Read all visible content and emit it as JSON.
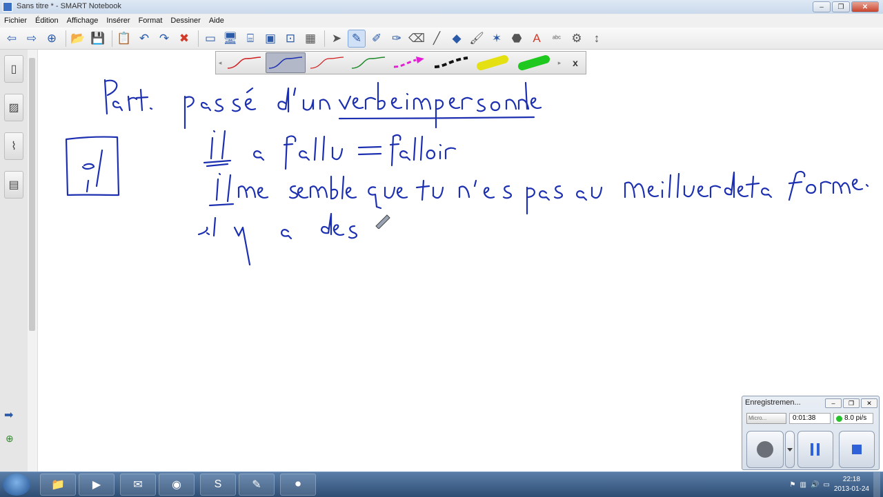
{
  "window": {
    "title": "Sans titre * - SMART Notebook",
    "minimize": "‒",
    "maximize": "❐",
    "close": "✕"
  },
  "menu": [
    "Fichier",
    "Édition",
    "Affichage",
    "Insérer",
    "Format",
    "Dessiner",
    "Aide"
  ],
  "toolbar": {
    "back_icon": "⇦",
    "forward_icon": "⇨",
    "add_page_icon": "⊕",
    "open_icon": "📂",
    "save_icon": "💾",
    "paste_icon": "📋",
    "undo_icon": "↶",
    "redo_icon": "↷",
    "delete_icon": "✖",
    "screen_shade_icon": "▭",
    "display_icon": "🖥",
    "document_camera_icon": "⌸",
    "presentation_icon": "▣",
    "capture_icon": "⊡",
    "table_icon": "▦",
    "select_icon": "➤",
    "pen_icon": "✎",
    "creative_pen_icon": "✐",
    "magic_pen_icon": "✑",
    "eraser_icon": "⌫",
    "line_icon": "╱",
    "shape_icon": "◆",
    "fill_icon": "🖌",
    "magic_icon": "✶",
    "paint_icon": "⬣",
    "text_icon": "A",
    "spellcheck_icon": "ᵃᵇᶜ",
    "measure_icon": "⚙",
    "more_icon": "↕"
  },
  "pen_tray": {
    "close": "x",
    "pens": [
      {
        "name": "red-thin",
        "color": "#d11d1d",
        "style": "curve"
      },
      {
        "name": "blue-thin",
        "color": "#1c2fb0",
        "style": "curve",
        "selected": true
      },
      {
        "name": "red-thin-2",
        "color": "#d11d1d",
        "style": "curve"
      },
      {
        "name": "green-thin",
        "color": "#1f8a2a",
        "style": "curve"
      },
      {
        "name": "magenta-arrow",
        "color": "#e21fd4",
        "style": "arrow"
      },
      {
        "name": "black-dash",
        "color": "#111111",
        "style": "dash"
      },
      {
        "name": "yellow-highlighter",
        "color": "#e4e012",
        "style": "highlighter"
      },
      {
        "name": "green-highlighter",
        "color": "#1ec81e",
        "style": "highlighter"
      }
    ]
  },
  "sidebar": {
    "tabs": [
      "page-sorter",
      "gallery",
      "attachments",
      "properties"
    ]
  },
  "handwriting": {
    "line1": "Part. passé d'un verbe impersonnel",
    "box": "il",
    "line2": "il a fallu = falloir",
    "line3": "il me semble que tu n'es pas au meilleur de ta forme.",
    "line4": "il y a des"
  },
  "recorder": {
    "title": "Enregistremen...",
    "time": "0:01:38",
    "fps": "8.0 pi/s",
    "select_value": "Micro...",
    "status_color": "#27c22b"
  },
  "taskbar": {
    "clock_time": "22:18",
    "clock_date": "2013-01-24"
  }
}
